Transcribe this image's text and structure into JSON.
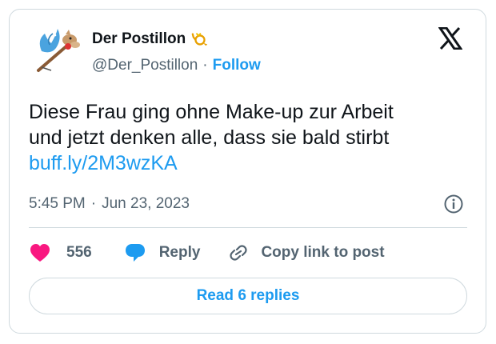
{
  "author": {
    "name": "Der Postillon",
    "handle": "@Der_Postillon",
    "separator": "·",
    "follow_label": "Follow"
  },
  "tweet": {
    "text_line1": "Diese Frau ging ohne Make-up zur Arbeit",
    "text_line2": "und jetzt denken alle, dass sie bald stirbt",
    "link_text": "buff.ly/2M3wzKA",
    "time": "5:45 PM",
    "time_separator": "·",
    "date": "Jun 23, 2023"
  },
  "actions": {
    "like_count": "556",
    "reply_label": "Reply",
    "copy_label": "Copy link to post"
  },
  "read_replies_label": "Read 6 replies",
  "colors": {
    "accent": "#1d9bf0",
    "like": "#f91880",
    "text": "#0f1419",
    "muted": "#536471",
    "border": "#cfd9de"
  },
  "icons": [
    "postillon-avatar",
    "post-horn-icon",
    "x-logo-icon",
    "info-icon",
    "heart-icon",
    "reply-bubble-icon",
    "link-icon"
  ]
}
